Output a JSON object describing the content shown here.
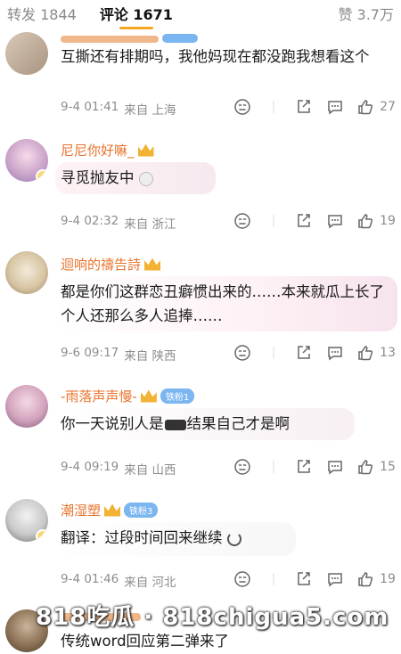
{
  "tabs": {
    "reposts": "转发 1844",
    "comments": "评论 1671",
    "likes": "赞 3.7万"
  },
  "comments": [
    {
      "user": "",
      "text": "互撕还有排期吗，我他妈现在都没跑我想看这个",
      "time": "9-4 01:41",
      "location": "来自 上海",
      "likes": "27"
    },
    {
      "user": "尼尼你好嘛_",
      "text": "寻觅抛友中",
      "time": "9-4 02:32",
      "location": "来自 浙江",
      "likes": "19"
    },
    {
      "user": "迴响的禱告詩",
      "text": "都是你们这群恋丑癖惯出来的……本来就瓜上长了个人还那么多人追捧……",
      "time": "9-6 09:17",
      "location": "来自 陕西",
      "likes": "13"
    },
    {
      "user": "-雨落声声慢-",
      "badge": "铁粉1",
      "text_before": "你一天说别人是",
      "text_after": "结果自己才是啊",
      "time": "9-4 09:19",
      "location": "来自 山西",
      "likes": "15"
    },
    {
      "user": "潮湿塑",
      "badge": "铁粉3",
      "text": "翻译：过段时间回来继续",
      "time": "9-4 01:46",
      "location": "来自 河北",
      "likes": "19"
    },
    {
      "user": "",
      "text": "传统word回应第二弹来了"
    }
  ],
  "watermark": "818吃瓜 · 818chigua5.com",
  "colors": {
    "username": "#e8722a",
    "meta": "#8d8d8d",
    "tab_indicator": "#f5a623"
  }
}
